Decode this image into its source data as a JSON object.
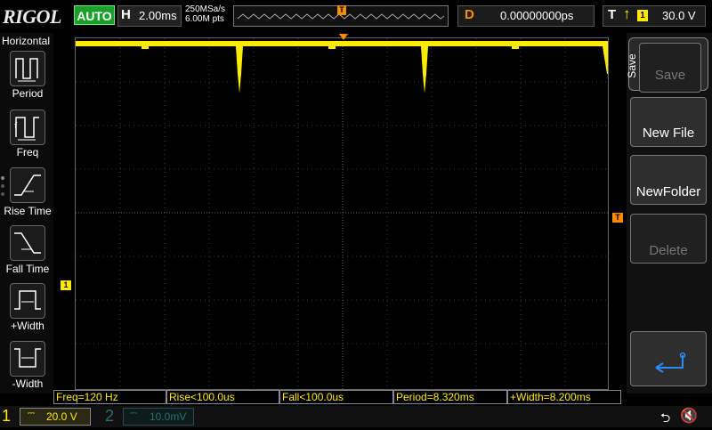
{
  "header": {
    "logo": "RIGOL",
    "run_mode": "AUTO",
    "horizontal_label": "H",
    "timebase": "2.00ms",
    "sample_rate": "250MSa/s",
    "memory_depth": "6.00M pts",
    "trigger_pos_marker": "T",
    "delay_label": "D",
    "delay_value": "0.00000000ps",
    "trigger_label": "T",
    "trigger_slope": "rising-edge-icon",
    "trigger_source": "1",
    "trigger_level": "30.0 V"
  },
  "left_menu": {
    "title": "Horizontal",
    "items": [
      {
        "label": "Period",
        "icon": "period-icon"
      },
      {
        "label": "Freq",
        "icon": "freq-icon"
      },
      {
        "label": "Rise Time",
        "icon": "rise-time-icon"
      },
      {
        "label": "Fall Time",
        "icon": "fall-time-icon"
      },
      {
        "label": "+Width",
        "icon": "pos-width-icon"
      },
      {
        "label": "-Width",
        "icon": "neg-width-icon"
      }
    ]
  },
  "right_menu": {
    "title": "Save",
    "items": [
      {
        "label": "Save",
        "enabled": false
      },
      {
        "label": "New File",
        "enabled": true
      },
      {
        "label": "NewFolder",
        "enabled": true
      },
      {
        "label": "Delete",
        "enabled": false
      },
      {
        "label": "",
        "icon": "return-arrow-icon",
        "enabled": true
      }
    ]
  },
  "markers": {
    "ch1_ground": "1",
    "trigger_level": "T"
  },
  "measurements": [
    "Freq=120 Hz",
    "Rise<100.0us",
    "Fall<100.0us",
    "Period=8.320ms",
    "+Width=8.200ms"
  ],
  "channels": {
    "ch1": {
      "number": "1",
      "coupling": "⎓",
      "scale": "20.0 V",
      "color": "#ffeb00"
    },
    "ch2": {
      "number": "2",
      "coupling": "⎓",
      "scale": "10.0mV",
      "color": "#2a6f74"
    }
  },
  "status": {
    "usb_icon": "usb-icon",
    "sound_icon": "speaker-muted-icon"
  },
  "colors": {
    "ch1": "#ffeb00",
    "trigger": "#ff8c00",
    "auto_bg": "#1aa02a"
  }
}
